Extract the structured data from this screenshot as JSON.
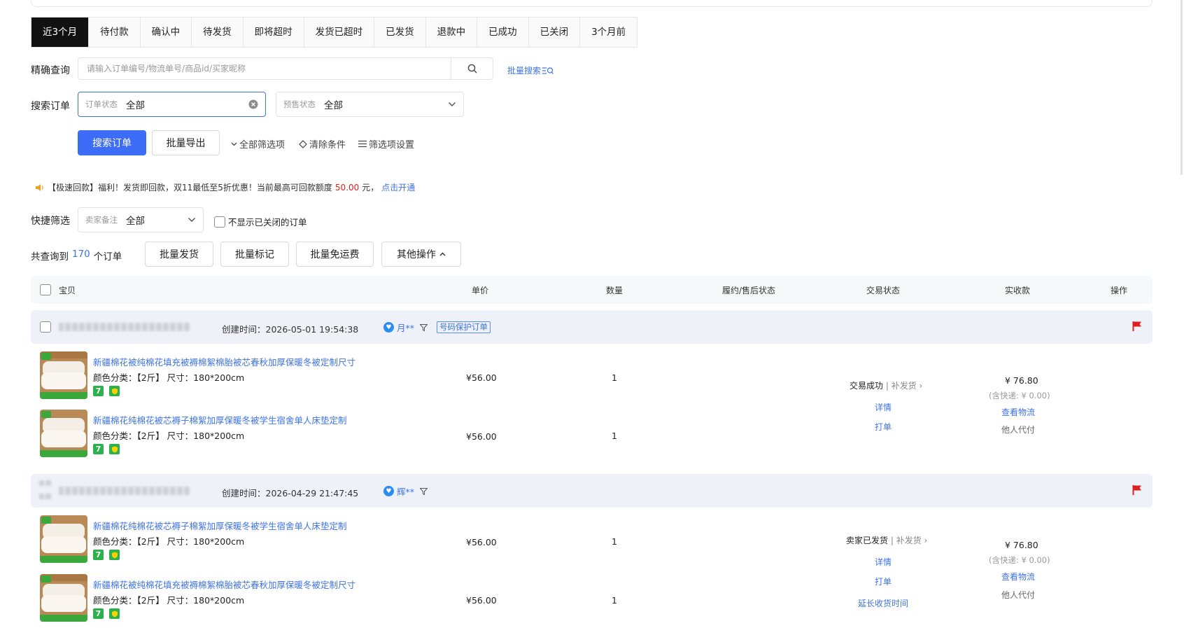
{
  "tabs": [
    "近3个月",
    "待付款",
    "确认中",
    "待发货",
    "即将超时",
    "发货已超时",
    "已发货",
    "退款中",
    "已成功",
    "已关闭",
    "3个月前"
  ],
  "active_tab": 0,
  "precise": {
    "label": "精确查询",
    "placeholder": "请输入订单编号/物流单号/商品id/买家昵称",
    "batch_search": "批量搜索"
  },
  "search_order": {
    "label": "搜索订单",
    "status_key": "订单状态",
    "status_value": "全部",
    "presale_key": "预售状态",
    "presale_value": "全部"
  },
  "actions": {
    "search": "搜索订单",
    "export": "批量导出",
    "all_filters": "全部筛选项",
    "clear": "清除条件",
    "filter_settings": "筛选项设置"
  },
  "notice": {
    "text": "【极速回款】福利！发货即回款，双11最低至5折优惠！当前最高可回款额度",
    "amount": "50.00",
    "unit": "元，",
    "link": "点击开通"
  },
  "quick": {
    "label": "快捷筛选",
    "remark_key": "卖家备注",
    "remark_value": "全部",
    "hide_closed": "不显示已关闭的订单"
  },
  "summary": {
    "prefix": "共查询到",
    "count": "170",
    "suffix": "个订单",
    "batch_ship": "批量发货",
    "batch_mark": "批量标记",
    "batch_free_ship": "批量免运费",
    "other": "其他操作"
  },
  "columns": {
    "item": "宝贝",
    "price": "单价",
    "qty": "数量",
    "fulfil": "履约/售后状态",
    "trade_status": "交易状态",
    "received": "实收款",
    "ops": "操作"
  },
  "orders": [
    {
      "created": "创建时间：2026-05-01 19:54:38",
      "buyer": "月**",
      "tag": "号码保护订单",
      "items": [
        {
          "title": "新疆棉花被纯棉花填充被褥棉絮棉胎被芯春秋加厚保暖冬被定制尺寸",
          "attr": "颜色分类：【2斤】 尺寸：180*200cm",
          "price": "¥56.00",
          "qty": "1"
        },
        {
          "title": "新疆棉花纯棉花被芯褥子棉絮加厚保暖冬被学生宿舍单人床垫定制",
          "attr": "颜色分类：【2斤】 尺寸：180*200cm",
          "price": "¥56.00",
          "qty": "1"
        }
      ],
      "status": "交易成功",
      "reship": "补发货",
      "ops": [
        "详情",
        "打单"
      ],
      "amount": "¥ 76.80",
      "shipping": "(含快递: ¥ 0.00)",
      "logistics": "查看物流",
      "proxy": "他人代付"
    },
    {
      "created": "创建时间：2026-04-29 21:47:45",
      "buyer": "辉**",
      "tag": "",
      "items": [
        {
          "title": "新疆棉花纯棉花被芯褥子棉絮加厚保暖冬被学生宿舍单人床垫定制",
          "attr": "颜色分类：【2斤】 尺寸：180*200cm",
          "price": "¥56.00",
          "qty": "1"
        },
        {
          "title": "新疆棉花被纯棉花填充被褥棉絮棉胎被芯春秋加厚保暖冬被定制尺寸",
          "attr": "颜色分类：【2斤】 尺寸：180*200cm",
          "price": "¥56.00",
          "qty": "1"
        }
      ],
      "status": "卖家已发货",
      "reship": "补发货",
      "ops": [
        "详情",
        "打单",
        "延长收货时间"
      ],
      "amount": "¥ 76.80",
      "shipping": "(含快递: ¥ 0.00)",
      "logistics": "查看物流",
      "proxy": "他人代付"
    }
  ],
  "colors": {
    "accent": "#3d6cf6",
    "link": "#3d73e6",
    "flag": "#e02020",
    "badge": "#2bb24c"
  }
}
